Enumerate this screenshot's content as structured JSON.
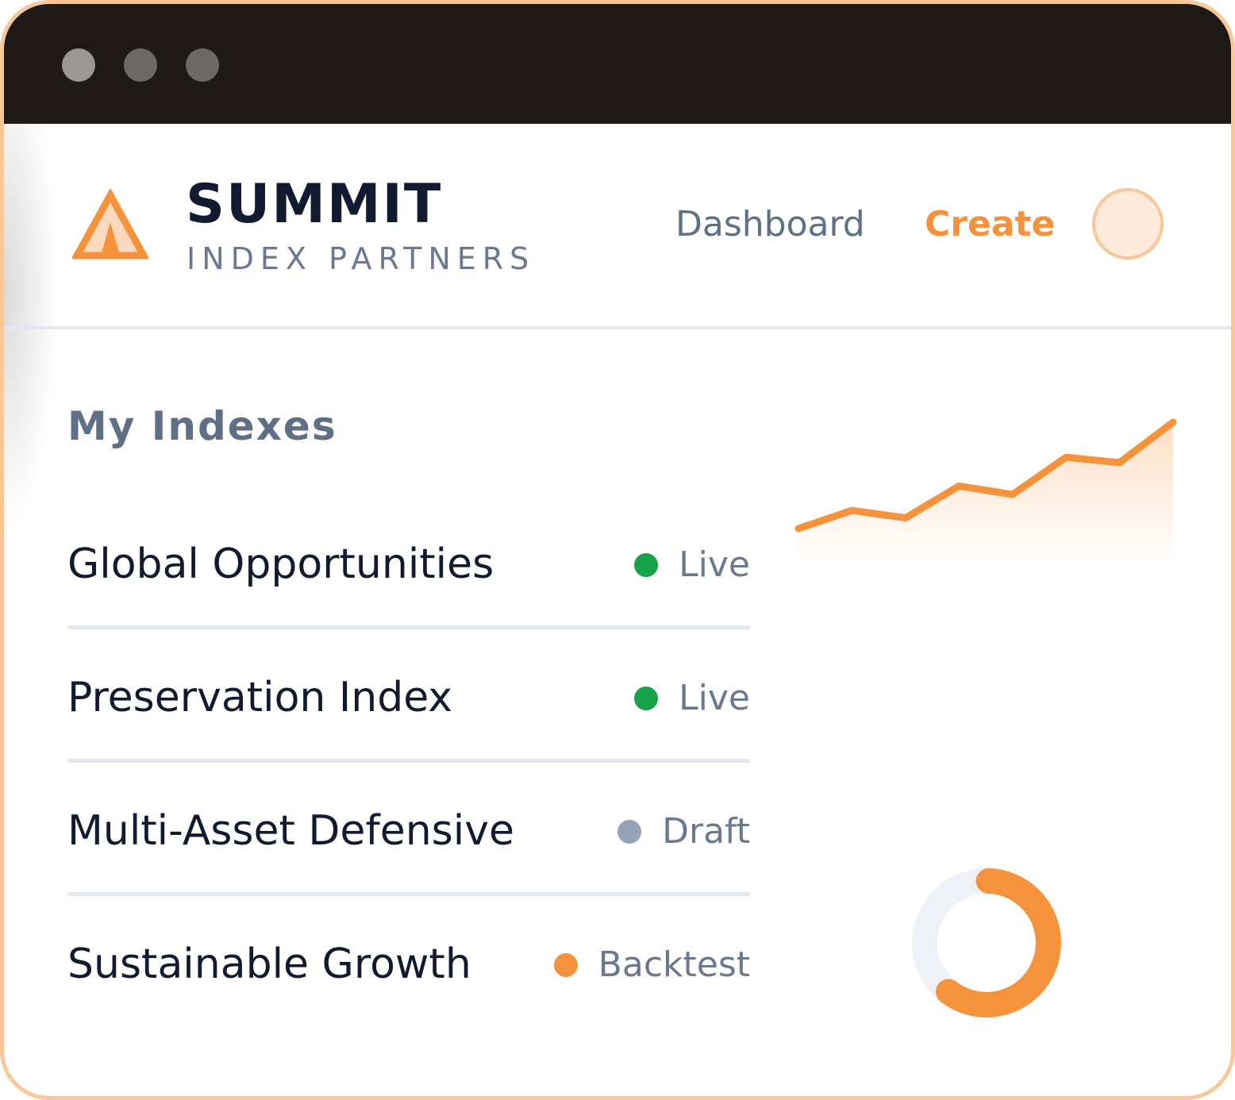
{
  "window": {
    "controls": [
      "close",
      "minimize",
      "maximize"
    ]
  },
  "header": {
    "brand_name": "SUMMIT",
    "brand_sub": "INDEX PARTNERS",
    "logo_icon": "mountain-logo-icon",
    "nav": {
      "dashboard_label": "Dashboard",
      "create_label": "Create"
    },
    "accent_color": "#f5923c"
  },
  "main": {
    "section_title": "My Indexes",
    "indexes": [
      {
        "name": "Global Opportunities",
        "status": "Live",
        "status_color": "#16a34a"
      },
      {
        "name": "Preservation Index",
        "status": "Live",
        "status_color": "#16a34a"
      },
      {
        "name": "Multi-Asset Defensive",
        "status": "Draft",
        "status_color": "#94a3b8"
      },
      {
        "name": "Sustainable Growth",
        "status": "Backtest",
        "status_color": "#f5923c"
      }
    ]
  },
  "chart_data": [
    {
      "type": "line",
      "x": [
        0,
        1,
        2,
        3,
        4,
        5,
        6,
        7
      ],
      "series": [
        {
          "values": [
            0.0,
            0.17,
            0.1,
            0.4,
            0.32,
            0.67,
            0.62,
            1.0
          ]
        }
      ],
      "color": "#f5923c",
      "grid": false
    },
    {
      "type": "pie",
      "style": "donut",
      "values": [
        0.6,
        0.4
      ],
      "colors": [
        "#f5923c",
        "#eef2f7"
      ]
    }
  ]
}
